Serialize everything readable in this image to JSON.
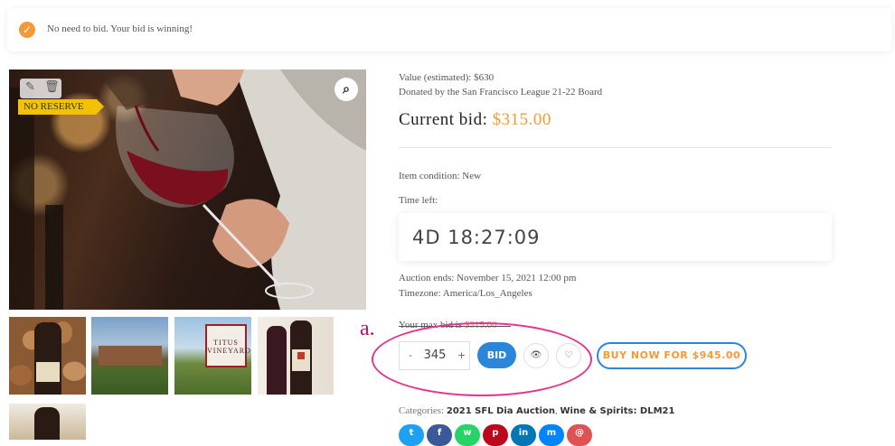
{
  "notice": {
    "message": "No need to bid. Your bid is winning!"
  },
  "product": {
    "no_reserve_badge": "NO RESERVE",
    "icons": {
      "edit": "edit-icon",
      "delete": "trash-icon",
      "zoom": "magnifier-icon"
    },
    "thumb_sign_text": "TITUS VINEYARDS"
  },
  "details": {
    "value_estimated": "Value (estimated): $630",
    "donated_by": "Donated by the San Francisco League 21-22 Board",
    "current_bid_label": "Current bid:",
    "current_bid_amount": "$315.00",
    "item_condition": "Item condition: New",
    "time_left_label": "Time left:",
    "time_left_value": "4D 18:27:09",
    "auction_ends": "Auction ends: November 15, 2021 12:00 pm",
    "timezone": "Timezone: America/Los_Angeles",
    "max_bid_label": "Your max bid is",
    "max_bid_value": "$315.00"
  },
  "bid_form": {
    "minus": "-",
    "quantity": "345",
    "plus": "+",
    "bid_button": "BID",
    "watch_icon": "eye-icon",
    "favorite_icon": "heart-icon",
    "buy_now_button": "BUY NOW FOR $945.00"
  },
  "annotation": {
    "marker": "a."
  },
  "categories": {
    "label": "Categories:",
    "items": [
      "2021 SFL Dia Auction",
      "Wine & Spirits: DLM21"
    ]
  },
  "share": [
    {
      "icon": "twitter-icon",
      "glyph": "t",
      "color": "#1da1f2"
    },
    {
      "icon": "facebook-icon",
      "glyph": "f",
      "color": "#3b5998"
    },
    {
      "icon": "whatsapp-icon",
      "glyph": "w",
      "color": "#25d366"
    },
    {
      "icon": "pinterest-icon",
      "glyph": "p",
      "color": "#bd081c"
    },
    {
      "icon": "linkedin-icon",
      "glyph": "in",
      "color": "#0077b5"
    },
    {
      "icon": "messenger-icon",
      "glyph": "m",
      "color": "#0084ff"
    },
    {
      "icon": "email-icon",
      "glyph": "@",
      "color": "#e05252"
    }
  ]
}
